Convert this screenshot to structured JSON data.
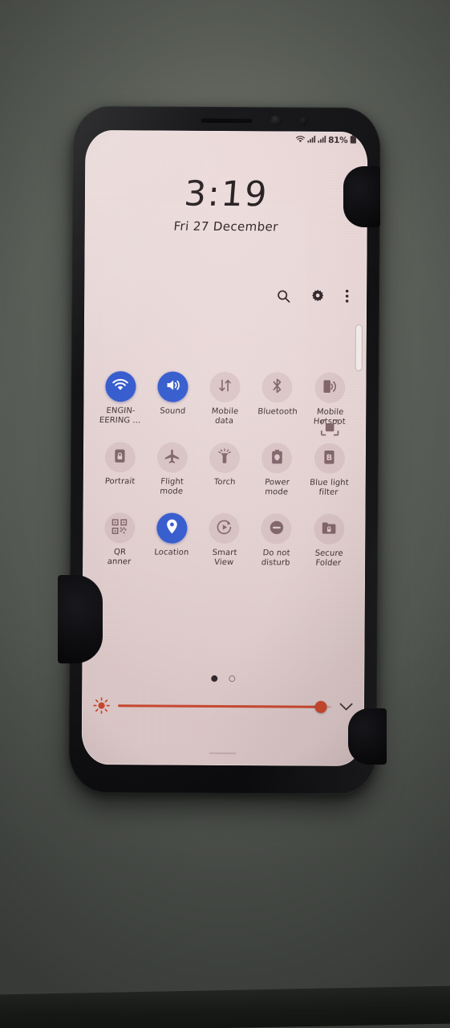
{
  "device": {
    "kind": "smartphone-photo",
    "background_color": "#575b58",
    "screen_tint": "#ead8d8"
  },
  "status_bar": {
    "wifi_icon": "wifi-icon",
    "signal_one_icon": "signal-bars-icon",
    "signal_two_icon": "signal-bars-icon",
    "battery_percent": "81%",
    "battery_icon": "battery-icon"
  },
  "clock": {
    "time": "3:19",
    "date": "Fri 27 December"
  },
  "header": {
    "search_icon": "search-icon",
    "settings_icon": "gear-icon",
    "more_icon": "more-vertical-icon"
  },
  "quick_settings": {
    "rows": [
      [
        {
          "name": "wifi",
          "label": "ENGIN-\nEERING ...",
          "icon": "wifi-icon",
          "active": true
        },
        {
          "name": "sound",
          "label": "Sound",
          "icon": "volume-icon",
          "active": true
        },
        {
          "name": "mobile-data",
          "label": "Mobile\ndata",
          "icon": "data-transfer-icon",
          "active": false
        },
        {
          "name": "bluetooth",
          "label": "Bluetooth",
          "icon": "bluetooth-icon",
          "active": false
        },
        {
          "name": "mobile-hotspot",
          "label": "Mobile\nHotspot",
          "icon": "hotspot-icon",
          "active": false
        }
      ],
      [
        {
          "name": "portrait",
          "label": "Portrait",
          "icon": "rotation-lock-icon",
          "active": false
        },
        {
          "name": "flight-mode",
          "label": "Flight\nmode",
          "icon": "airplane-icon",
          "active": false
        },
        {
          "name": "torch",
          "label": "Torch",
          "icon": "flashlight-icon",
          "active": false
        },
        {
          "name": "power-mode",
          "label": "Power\nmode",
          "icon": "battery-saver-icon",
          "active": false
        },
        {
          "name": "blue-light-filter",
          "label": "Blue light\nfilter",
          "icon": "blue-light-icon",
          "active": false
        }
      ],
      [
        {
          "name": "qr-scanner",
          "label": "QR\nanner",
          "icon": "qr-code-icon",
          "active": false
        },
        {
          "name": "location",
          "label": "Location",
          "icon": "location-pin-icon",
          "active": true
        },
        {
          "name": "smart-view",
          "label": "Smart\nView",
          "icon": "smart-view-icon",
          "active": false
        },
        {
          "name": "do-not-disturb",
          "label": "Do not\ndisturb",
          "icon": "do-not-disturb-icon",
          "active": false
        },
        {
          "name": "secure-folder",
          "label": "Secure\nFolder",
          "icon": "secure-folder-icon",
          "active": false
        }
      ]
    ],
    "capture_overlay_icon": "screenshot-capture-icon",
    "active_color": "#2f58cf",
    "inactive_icon_color": "#7d6167"
  },
  "pager": {
    "total_pages": 2,
    "current_page": 1
  },
  "brightness": {
    "sun_icon": "brightness-sun-icon",
    "expand_icon": "chevron-down-icon",
    "value_percent": 95,
    "slider_color": "#c8442b"
  }
}
